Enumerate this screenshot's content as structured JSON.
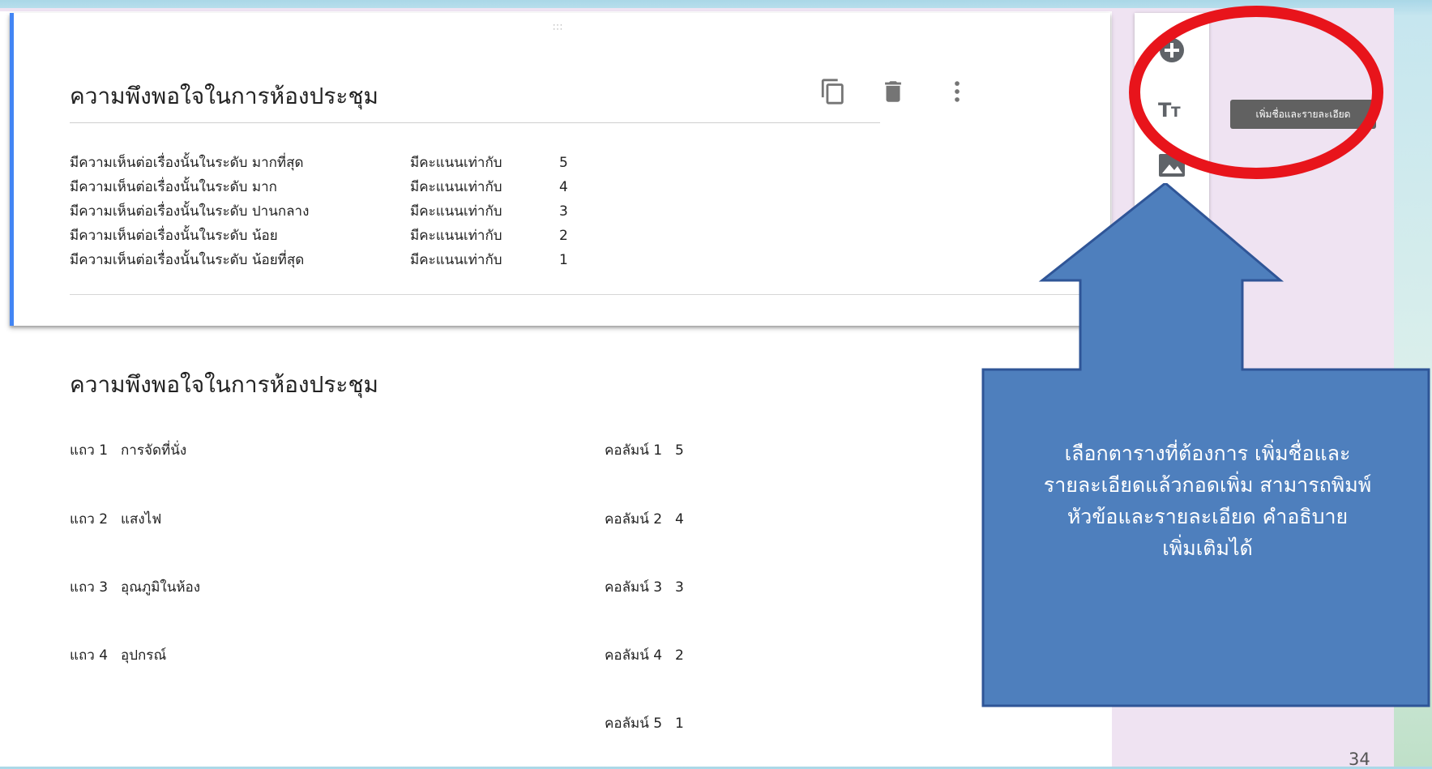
{
  "form": {
    "editing_card": {
      "title": "ความพึงพอใจในการห้องประชุม",
      "description_rows": [
        {
          "level": "มีความเห็นต่อเรื่องนั้นในระดับ มากที่สุด",
          "label": "มีคะแนนเท่ากับ",
          "score": "5"
        },
        {
          "level": "มีความเห็นต่อเรื่องนั้นในระดับ มาก",
          "label": "มีคะแนนเท่ากับ",
          "score": "4"
        },
        {
          "level": "มีความเห็นต่อเรื่องนั้นในระดับ ปานกลาง",
          "label": "มีคะแนนเท่ากับ",
          "score": "3"
        },
        {
          "level": "มีความเห็นต่อเรื่องนั้นในระดับ น้อย",
          "label": "มีคะแนนเท่ากับ",
          "score": "2"
        },
        {
          "level": "มีความเห็นต่อเรื่องนั้นในระดับ น้อยที่สุด",
          "label": "มีคะแนนเท่ากับ",
          "score": "1"
        }
      ],
      "actions": [
        "copy-icon",
        "delete-icon",
        "more-vert-icon"
      ]
    },
    "grid_question": {
      "title": "ความพึงพอใจในการห้องประชุม",
      "rows": [
        {
          "label": "แถว 1",
          "value": "การจัดที่นั่ง"
        },
        {
          "label": "แถว 2",
          "value": "แสงไฟ"
        },
        {
          "label": "แถว 3",
          "value": "อุณภูมิในห้อง"
        },
        {
          "label": "แถว 4",
          "value": "อุปกรณ์"
        }
      ],
      "columns": [
        {
          "label": "คอลัมน์ 1",
          "value": "5"
        },
        {
          "label": "คอลัมน์ 2",
          "value": "4"
        },
        {
          "label": "คอลัมน์ 3",
          "value": "3"
        },
        {
          "label": "คอลัมน์ 4",
          "value": "2"
        },
        {
          "label": "คอลัมน์ 5",
          "value": "1"
        }
      ]
    }
  },
  "toolbar": {
    "buttons": [
      "add-question-icon",
      "add-title-description-icon",
      "add-image-icon",
      "add-video-icon",
      "add-section-icon"
    ],
    "tooltip": "เพิ่มชื่อและรายละเอียด"
  },
  "annotation": {
    "lines": [
      "เลือกตารางที่ต้องการ เพิ่มชื่อและ",
      "รายละเอียดแล้วกอดเพิ่ม สามารถพิมพ์",
      "หัวข้อและรายละเอียด คำอธิบาย",
      "เพิ่มเติมได้"
    ],
    "highlight_color": "#e8141b",
    "arrow_color": "#4e7fbd",
    "arrow_border": "#2f5597"
  },
  "slide_number": "34",
  "colors": {
    "accent": "#4285f4",
    "page_background": "#efe3f2",
    "tooltip_background": "#616161"
  }
}
